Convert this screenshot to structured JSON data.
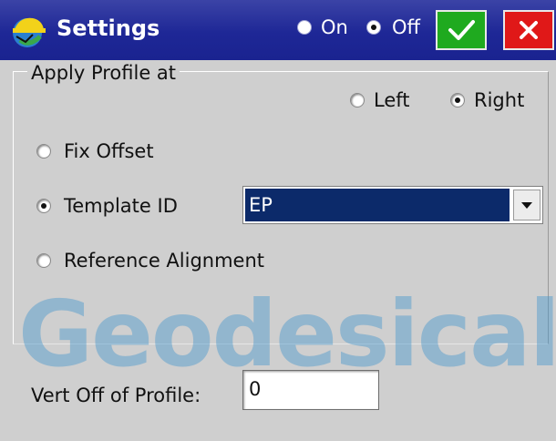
{
  "titlebar": {
    "title": "Settings",
    "on_label": "On",
    "off_label": "Off",
    "selected_power": "Off",
    "ok_icon": "checkmark-icon",
    "cancel_icon": "close-icon",
    "ok_color": "#1faa1f",
    "cancel_color": "#e01818"
  },
  "apply_profile": {
    "group_label": "Apply Profile at",
    "side_options": [
      "Left",
      "Right"
    ],
    "side_selected": "Right",
    "options": [
      "Fix Offset",
      "Template ID",
      "Reference Alignment"
    ],
    "selected": "Template ID",
    "template_value": "EP"
  },
  "vert_offset": {
    "label": "Vert Off of Profile:",
    "value": "0"
  },
  "watermark": "Geodesical"
}
